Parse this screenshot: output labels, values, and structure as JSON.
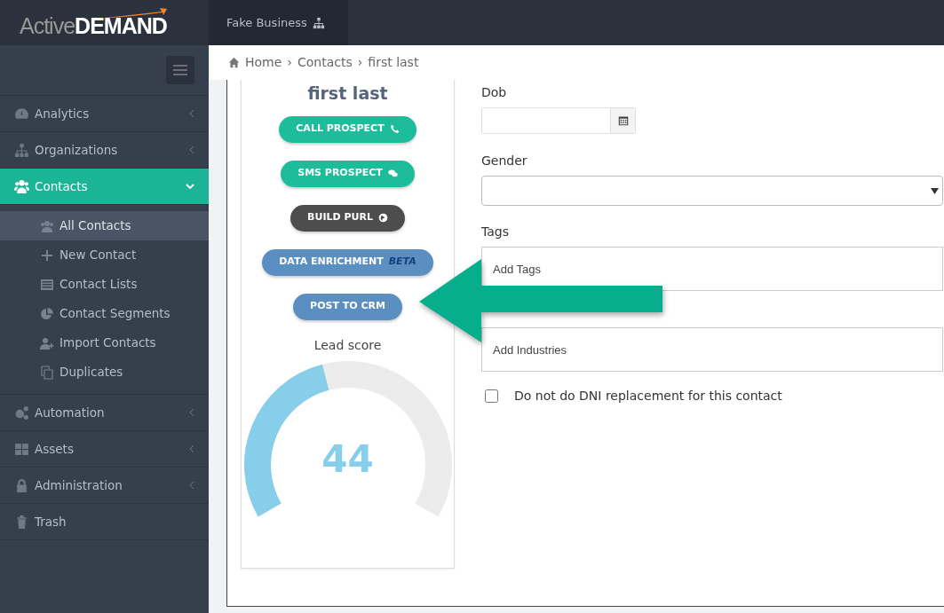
{
  "brand": {
    "light": "Active",
    "bold": "DEMAND"
  },
  "account": {
    "label": "Fake Business"
  },
  "breadcrumb": [
    {
      "label": "Home"
    },
    {
      "separator": "›",
      "label": "Contacts"
    },
    {
      "separator": "›",
      "label": "first last"
    }
  ],
  "sidebar": {
    "items": [
      {
        "label": "Analytics",
        "selected": false,
        "expanded": false
      },
      {
        "label": "Organizations",
        "selected": false,
        "expanded": false
      },
      {
        "label": "Contacts",
        "selected": true,
        "expanded": true,
        "children": [
          {
            "label": "All Contacts",
            "selected": true
          },
          {
            "label": "New Contact",
            "selected": false
          },
          {
            "label": "Contact Lists",
            "selected": false
          },
          {
            "label": "Contact Segments",
            "selected": false
          },
          {
            "label": "Import Contacts",
            "selected": false
          },
          {
            "label": "Duplicates",
            "selected": false
          }
        ]
      },
      {
        "label": "Automation",
        "selected": false,
        "expanded": false
      },
      {
        "label": "Assets",
        "selected": false,
        "expanded": false
      },
      {
        "label": "Administration",
        "selected": false,
        "expanded": false
      },
      {
        "label": "Trash",
        "selected": false
      }
    ]
  },
  "profile": {
    "name": "first last",
    "buttons": [
      {
        "label": "CALL PROSPECT",
        "kind": "call"
      },
      {
        "label": "SMS PROSPECT",
        "kind": "sms"
      },
      {
        "label": "BUILD PURL",
        "kind": "purl"
      },
      {
        "label": "DATA ENRICHMENT",
        "kind": "enrich",
        "tag": "BETA"
      },
      {
        "label": "POST TO CRM",
        "kind": "crm"
      }
    ],
    "lead_score": {
      "title": "Lead score",
      "value": "44",
      "level": 0.44
    }
  },
  "form": {
    "dob": {
      "label": "Dob"
    },
    "gender": {
      "label": "Gender"
    },
    "tags": {
      "label": "Tags",
      "placeholder": "Add Tags"
    },
    "industries": {
      "placeholder": "Add Industries"
    },
    "dni": {
      "label": "Do not do DNI replacement for this contact",
      "checked": false
    }
  }
}
